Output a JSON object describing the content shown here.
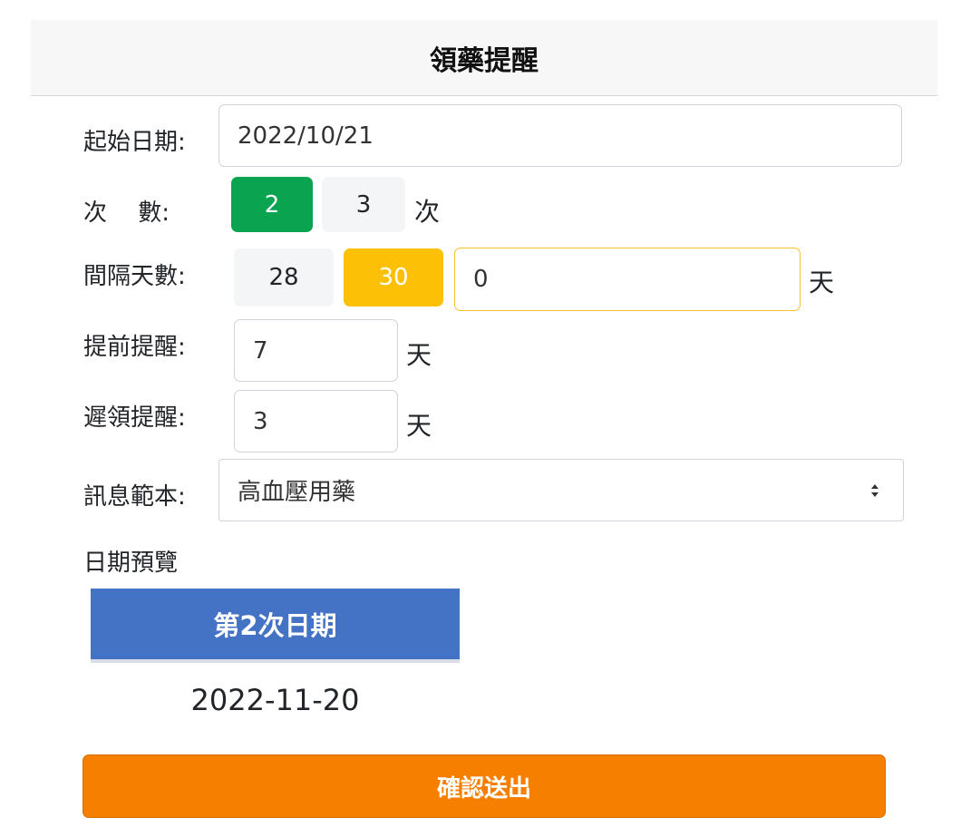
{
  "header": {
    "title": "領藥提醒"
  },
  "form": {
    "start_date": {
      "label": "起始日期:",
      "value": "2022/10/21"
    },
    "times": {
      "label": "次　 數:",
      "options": [
        "2",
        "3"
      ],
      "selected": "2",
      "unit": "次"
    },
    "interval": {
      "label": "間隔天數:",
      "options": [
        "28",
        "30"
      ],
      "selected": "30",
      "custom_value": "0",
      "unit": "天"
    },
    "advance": {
      "label": "提前提醒:",
      "value": "7",
      "unit": "天"
    },
    "late": {
      "label": "遲領提醒:",
      "value": "3",
      "unit": "天"
    },
    "template": {
      "label": "訊息範本:",
      "selected": "高血壓用藥"
    }
  },
  "preview": {
    "title": "日期預覽",
    "columns": [
      "第2次日期"
    ],
    "rows": [
      [
        "2022-11-20"
      ]
    ]
  },
  "submit_label": "確認送出",
  "colors": {
    "selected_times": "#0aa34f",
    "selected_interval": "#fcc106",
    "table_header": "#4472c4",
    "submit": "#f77f00"
  }
}
